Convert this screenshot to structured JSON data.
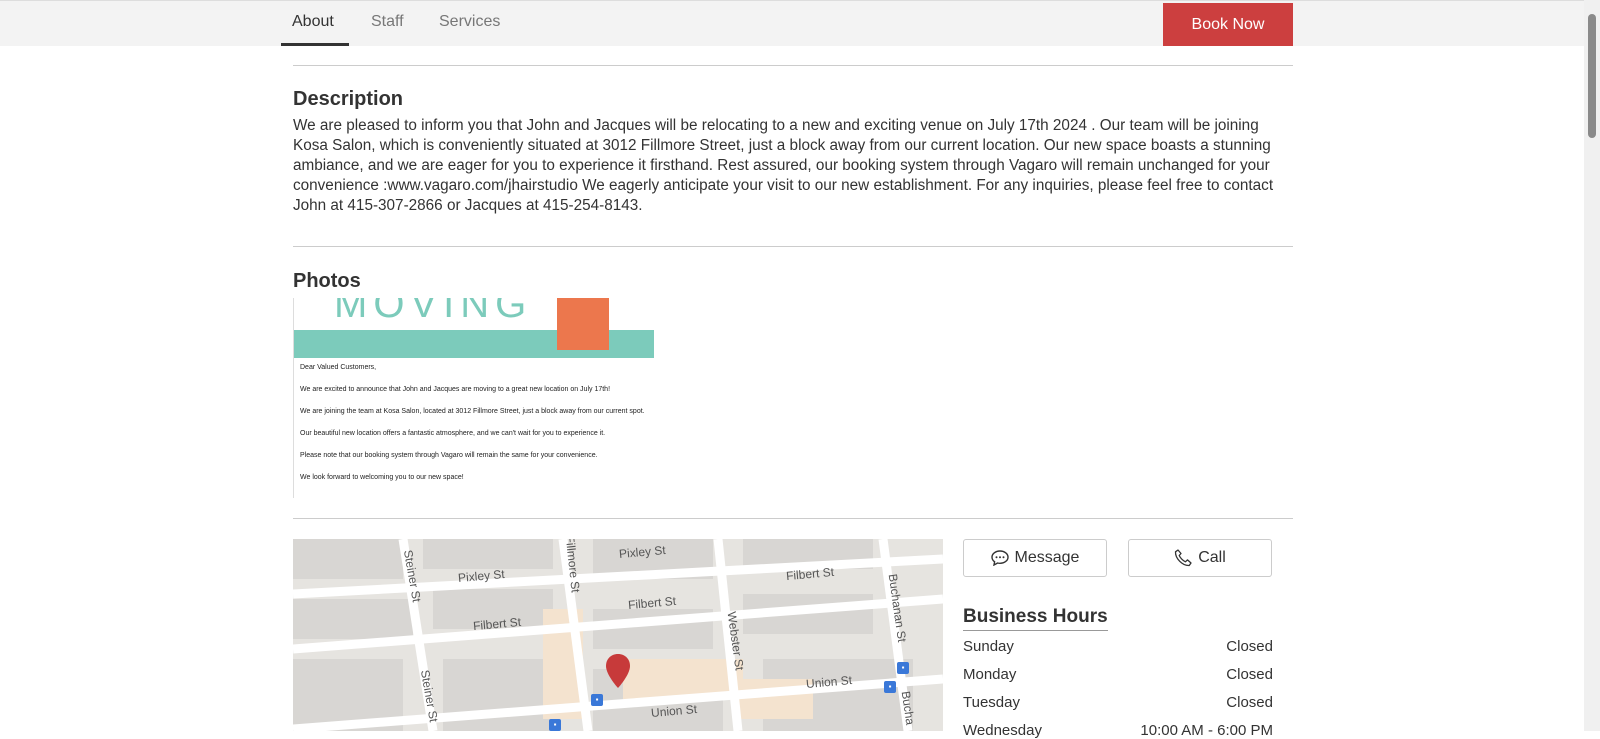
{
  "nav": {
    "tabs": [
      {
        "label": "About",
        "active": true
      },
      {
        "label": "Staff",
        "active": false
      },
      {
        "label": "Services",
        "active": false
      }
    ],
    "book_now": "Book Now"
  },
  "description": {
    "title": "Description",
    "body": "We are pleased to inform you that John and Jacques will be relocating to a new and exciting venue on July 17th 2024 . Our team will be joining Kosa Salon, which is conveniently situated at 3012 Fillmore Street, just a block away from our current location. Our new space boasts a stunning ambiance, and we are eager for you to experience it firsthand. Rest assured, our booking system through Vagaro will remain unchanged for your convenience :www.vagaro.com/jhairstudio We eagerly anticipate your visit to our new establishment. For any inquiries, please feel free to contact John at 415-307-2866 or Jacques at 415-254-8143."
  },
  "photos": {
    "title": "Photos",
    "image": {
      "heading": "MOVING",
      "greeting": "Dear Valued Customers,",
      "lines": [
        "We are excited to announce that John and Jacques are moving to a great new location on July 17th!",
        "We are joining the team at Kosa Salon, located at 3012 Fillmore Street, just a block away from our current spot.",
        "Our beautiful new location offers a fantastic atmosphere, and we can't wait for you to experience it.",
        "Please note that our booking system through Vagaro will remain the same for your convenience.",
        "We look forward to welcoming you to our new space!"
      ]
    }
  },
  "map": {
    "streets": [
      "Pixley St",
      "Pixley St",
      "Fillmore St",
      "Filbert St",
      "Filbert St",
      "Filbert St",
      "Steiner St",
      "Steiner St",
      "Webster St",
      "Buchanan St",
      "Union St",
      "Union St",
      "Bucha"
    ]
  },
  "actions": {
    "message": "Message",
    "call": "Call"
  },
  "hours": {
    "title": "Business Hours",
    "days": [
      {
        "day": "Sunday",
        "time": "Closed"
      },
      {
        "day": "Monday",
        "time": "Closed"
      },
      {
        "day": "Tuesday",
        "time": "Closed"
      },
      {
        "day": "Wednesday",
        "time": "10:00 AM - 6:00 PM"
      }
    ]
  },
  "colors": {
    "brand_red": "#cc3f3f",
    "teal": "#7ccbbb",
    "orange": "#ec774d",
    "bus_blue": "#3a78d8"
  }
}
